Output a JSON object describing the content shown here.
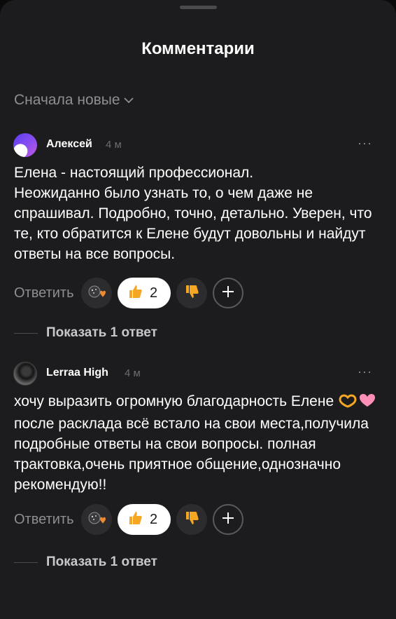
{
  "header": {
    "title": "Комментарии"
  },
  "sort": {
    "label": "Сначала новые"
  },
  "comments": [
    {
      "author": "Алексей",
      "time": "4 м",
      "more": "···",
      "text": "Елена - настоящий профессионал.\nНеожиданно было узнать то, о чем даже не спрашивал. Подробно, точно, детально. Уверен, что те, кто обратится к Елене будут довольны и найдут ответы на все вопросы.",
      "reply_label": "Ответить",
      "likes": "2",
      "thread_label": "Показать 1 ответ"
    },
    {
      "author": "Lerraa High",
      "time": "4 м",
      "more": "···",
      "text_before": "хочу выразить огромную благодарность Елене",
      "text_after": " после расклада всё встало на свои места,получила подробные ответы на свои вопросы. полная трактовка,очень приятное общение,однозначно рекомендую!!",
      "reply_label": "Ответить",
      "likes": "2",
      "thread_label": "Показать 1 ответ"
    }
  ],
  "icons": {
    "sort": "chevron-down-icon",
    "more": "more-dots-icon",
    "reaction": "reaction-icon",
    "like": "thumbs-up-icon",
    "dislike": "thumbs-down-icon",
    "add": "plus-icon",
    "emoji": "heart-hands-emoji"
  },
  "colors": {
    "background": "#1c1c1e",
    "text": "#ffffff",
    "muted": "#8e8e93",
    "like_pill": "#ffffff",
    "thumb": "#f5a623"
  }
}
